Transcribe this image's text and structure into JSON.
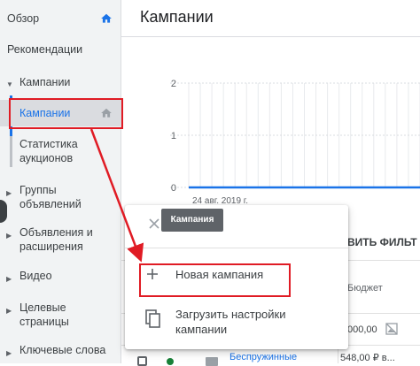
{
  "sidebar": {
    "overview": "Обзор",
    "recommendations": "Рекомендации",
    "campaigns_group": "Кампании",
    "campaigns_active": "Кампании",
    "auction_stats_line1": "Статистика",
    "auction_stats_line2": "аукционов",
    "ad_groups_line1": "Группы",
    "ad_groups_line2": "объявлений",
    "ads_line1": "Объявления и",
    "ads_line2": "расширения",
    "video": "Видео",
    "landing_line1": "Целевые",
    "landing_line2": "страницы",
    "keywords": "Ключевые слова"
  },
  "header": {
    "title": "Кампании"
  },
  "chart_data": {
    "type": "line",
    "yticks": [
      "2",
      "1",
      "0"
    ],
    "ylim": [
      0,
      2
    ],
    "x_start_label": "24 авг. 2019 г.",
    "series": [
      {
        "values": [
          0,
          0,
          0,
          0,
          0,
          0,
          0,
          0,
          0,
          0,
          0,
          0,
          0,
          0,
          0,
          0,
          0,
          0,
          0,
          0
        ]
      }
    ],
    "grid": true
  },
  "table": {
    "filter_button": "ВИТЬ ФИЛЬТ",
    "budget_header": "Бюджет",
    "row1_budget": "000,00",
    "row2_name": "Беспружинные",
    "row2_budget": "548,00 ₽ в..."
  },
  "menu": {
    "tooltip": "Кампания",
    "new_campaign": "Новая кампания",
    "upload_line1": "Загрузить настройки",
    "upload_line2": "кампании"
  },
  "colors": {
    "accent": "#1a73e8",
    "annotation": "#e01b24",
    "status_green": "#188038"
  },
  "icons": [
    "home-icon",
    "plus-icon",
    "copy-icon",
    "close-icon",
    "checkbox",
    "status-dot-icon",
    "image-icon"
  ]
}
